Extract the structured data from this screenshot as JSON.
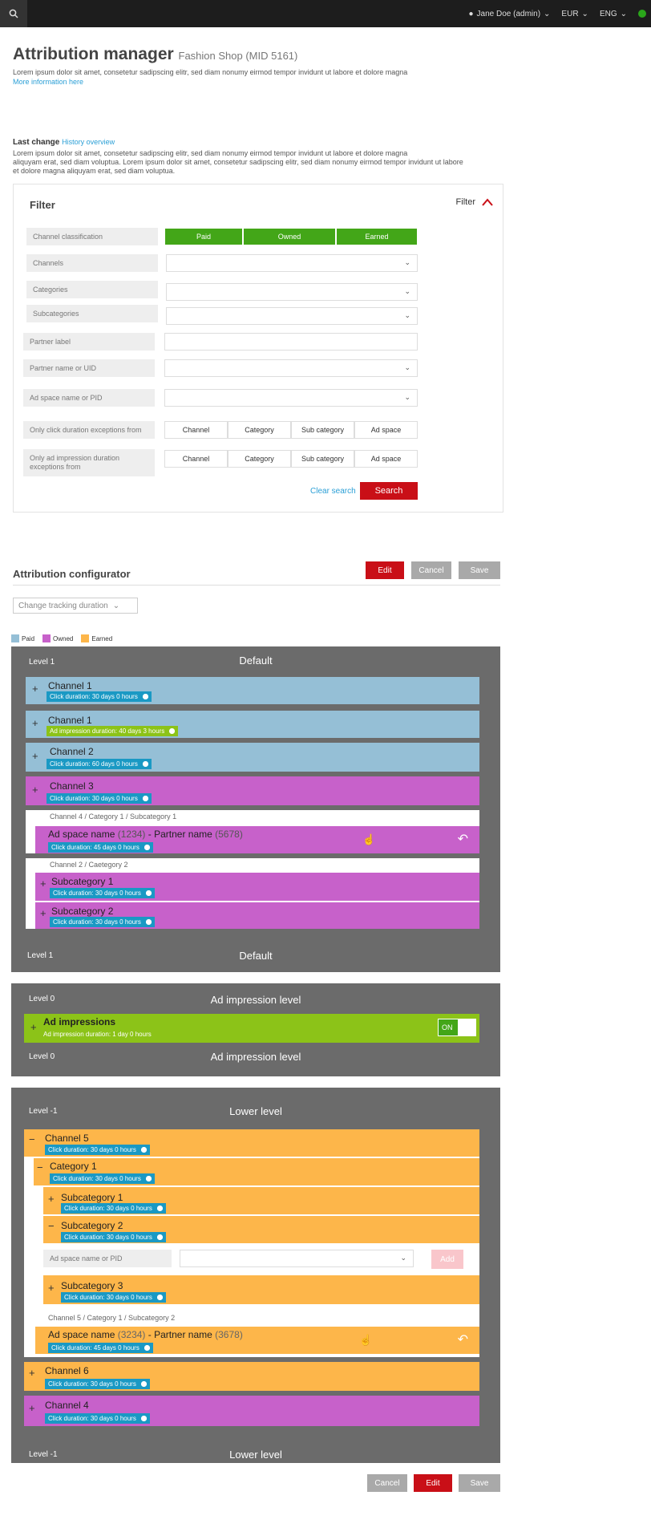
{
  "topbar": {
    "user": "Jane Doe (admin)",
    "currency": "EUR",
    "language": "ENG"
  },
  "header": {
    "title": "Attribution manager",
    "subtitle": "Fashion Shop (MID 5161)",
    "description": "Lorem ipsum dolor sit amet, consetetur sadipscing elitr, sed diam nonumy eirmod tempor invidunt ut labore et dolore magna",
    "more_link": "More information here"
  },
  "last_change": {
    "label": "Last change",
    "history_link": "History overview",
    "text1": "Lorem ipsum dolor sit amet, consetetur sadipscing elitr, sed diam nonumy eirmod tempor invidunt ut labore et dolore magna",
    "text2": "aliquyam erat, sed diam voluptua. Lorem ipsum dolor sit amet, consetetur sadipscing elitr, sed diam nonumy eirmod tempor invidunt ut labore",
    "text3": "et dolore magna aliquyam erat, sed diam voluptua."
  },
  "filter": {
    "title": "Filter",
    "toggle_label": "Filter",
    "channel_classification": "Channel classification",
    "classes": [
      "Paid",
      "Owned",
      "Earned"
    ],
    "channels": "Channels",
    "categories": "Categories",
    "subcategories": "Subcategories",
    "partner_label": "Partner label",
    "partner_name": "Partner name or UID",
    "ad_space": "Ad space name or PID",
    "click_exceptions": "Only click duration exceptions from",
    "impression_exceptions_1": "Only ad impression duration",
    "impression_exceptions_2": "exceptions from",
    "exception_options": [
      "Channel",
      "Category",
      "Sub category",
      "Ad space"
    ],
    "clear": "Clear search",
    "search": "Search"
  },
  "configurator": {
    "title": "Attribution configurator",
    "edit": "Edit",
    "cancel": "Cancel",
    "save": "Save",
    "dropdown": "Change tracking duration"
  },
  "legend": {
    "paid": "Paid",
    "owned": "Owned",
    "earned": "Earned",
    "colors": {
      "paid": "#95bfd6",
      "owned": "#c761ca",
      "earned": "#fdb64a"
    }
  },
  "level1": {
    "level": "Level 1",
    "title": "Default",
    "rows": [
      {
        "plus": "+",
        "name": "Channel 1",
        "tag": "Click duration: 30 days   0 hours"
      },
      {
        "plus": "+",
        "name": "Channel 1",
        "tag": "Ad impression duration: 40 days   3 hours"
      },
      {
        "plus": "+",
        "name": "Channel 2",
        "tag": "Click duration: 60 days   0 hours"
      },
      {
        "plus": "+",
        "name": "Channel 3",
        "tag": "Click duration: 30 days   0 hours"
      }
    ],
    "crumb1": "Channel 4  / Category 1 / Subcategory 1",
    "adspace1": {
      "name": "Ad space name",
      "pid": "(1234)",
      "sep": " -  ",
      "partner": "Partner name",
      "uid": "(5678)",
      "tag": "Click duration: 45 days   0 hours"
    },
    "crumb2": "Channel 2  / Caetegory 2",
    "sub1": {
      "plus": "+",
      "name": "Subcategory 1",
      "tag": "Click duration: 30 days   0 hours"
    },
    "sub2": {
      "plus": "+",
      "name": "Subcategory 2",
      "tag": "Click duration: 30 days   0 hours"
    }
  },
  "level0": {
    "level": "Level 0",
    "title": "Ad impression  level",
    "plus": "+",
    "name": "Ad impressions",
    "desc": "Ad impression duration: 1 day   0 hours",
    "toggle": "ON"
  },
  "levelm1": {
    "level": "Level -1",
    "title": "Lower level",
    "ch5": {
      "plus": "−",
      "name": "Channel 5",
      "tag": "Click duration: 30 days   0 hours"
    },
    "cat1": {
      "plus": "−",
      "name": "Category 1",
      "tag": "Click duration: 30 days   0 hours"
    },
    "sub1": {
      "plus": "+",
      "name": "Subcategory 1",
      "tag": "Click duration: 30 days   0 hours"
    },
    "sub2": {
      "plus": "−",
      "name": "Subcategory 2",
      "tag": "Click duration: 30 days   0 hours"
    },
    "adspace_label": "Ad space name or PID",
    "add": "Add",
    "sub3": {
      "plus": "+",
      "name": "Subcategory 3",
      "tag": "Click duration: 30 days   0 hours"
    },
    "crumb": "Channel 5  / Category 1 / Subcategory 2",
    "adspace": {
      "name": "Ad space name",
      "pid": "(3234)",
      "sep": " -  ",
      "partner": "Partner name",
      "uid": "(3678)",
      "tag": "Click duration: 45 days   0 hours"
    },
    "ch6": {
      "plus": "+",
      "name": "Channel 6",
      "tag": "Click duration: 30 days   0 hours"
    },
    "ch4": {
      "plus": "+",
      "name": "Channel 4",
      "tag": "Click duration: 30 days   0 hours"
    }
  },
  "footer": {
    "cancel": "Cancel",
    "edit": "Edit",
    "save": "Save"
  }
}
